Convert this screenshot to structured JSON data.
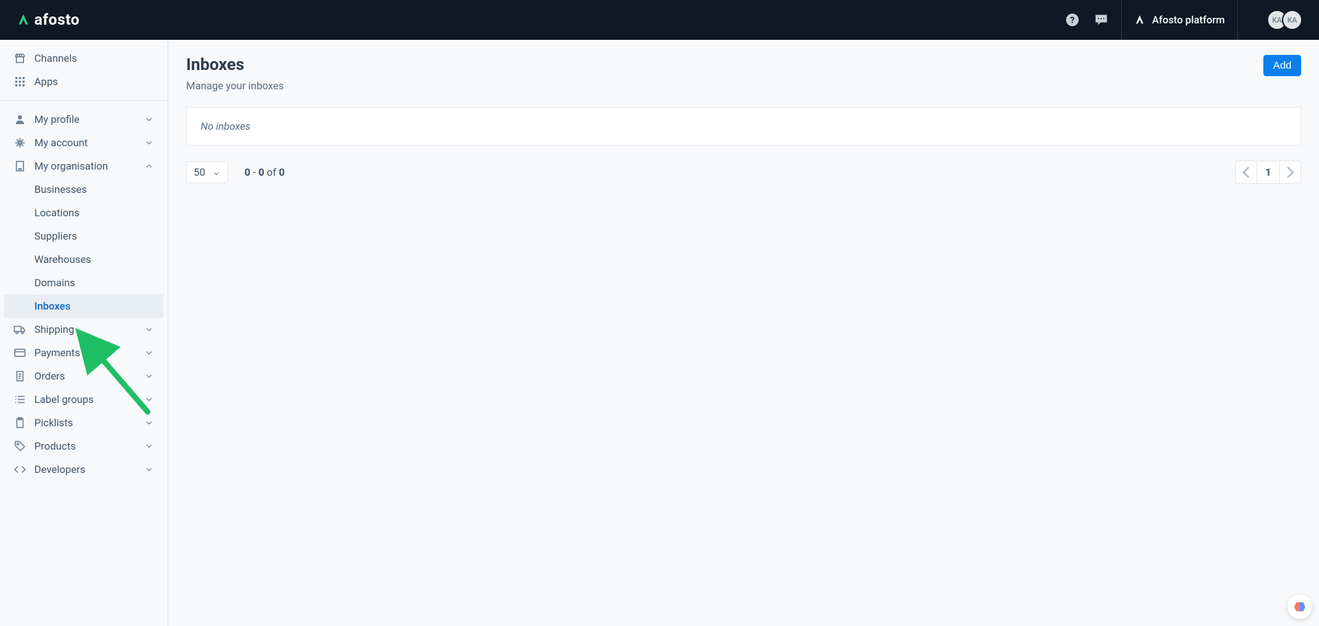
{
  "header": {
    "logo_text": "afosto",
    "platform_link": "Afosto platform",
    "avatar_initials": [
      "KA",
      "KA"
    ]
  },
  "sidebar": {
    "top": [
      {
        "label": "Channels"
      },
      {
        "label": "Apps"
      }
    ],
    "nav": [
      {
        "label": "My profile",
        "expanded": false
      },
      {
        "label": "My account",
        "expanded": false
      },
      {
        "label": "My organisation",
        "expanded": true
      },
      {
        "label": "Shipping",
        "expanded": false
      },
      {
        "label": "Payments",
        "expanded": false
      },
      {
        "label": "Orders",
        "expanded": false
      },
      {
        "label": "Label groups",
        "expanded": false
      },
      {
        "label": "Picklists",
        "expanded": false
      },
      {
        "label": "Products",
        "expanded": false
      },
      {
        "label": "Developers",
        "expanded": false
      }
    ],
    "my_org_sub": [
      {
        "label": "Businesses"
      },
      {
        "label": "Locations"
      },
      {
        "label": "Suppliers"
      },
      {
        "label": "Warehouses"
      },
      {
        "label": "Domains"
      },
      {
        "label": "Inboxes"
      }
    ]
  },
  "main": {
    "title": "Inboxes",
    "subtitle": "Manage your inboxes",
    "add_button": "Add",
    "empty_text": "No inboxes",
    "page_size": "50",
    "page_info": {
      "from": "0",
      "to": "0",
      "sep": " - ",
      "of_word": " of ",
      "total": "0"
    },
    "current_page": "1"
  }
}
